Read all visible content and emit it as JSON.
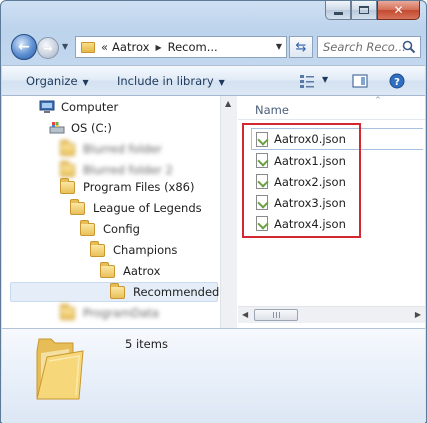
{
  "window": {
    "caption": {
      "minimize": "minimize",
      "maximize": "maximize",
      "close": "close"
    }
  },
  "address_bar": {
    "overflow": "«",
    "segments": [
      "Aatrox",
      "Recom..."
    ],
    "search_placeholder": "Search Reco..."
  },
  "toolbar": {
    "organize": "Organize",
    "include_in_library": "Include in library"
  },
  "nav_tree": [
    {
      "label": "Computer",
      "icon": "computer-icon",
      "blurred": false
    },
    {
      "label": "OS (C:)",
      "icon": "drive-icon",
      "blurred": false
    },
    {
      "label": "Blurred folder",
      "icon": "folder-icon",
      "blurred": true
    },
    {
      "label": "Blurred folder 2",
      "icon": "folder-icon",
      "blurred": true
    },
    {
      "label": "Program Files (x86)",
      "icon": "folder-icon",
      "blurred": false
    },
    {
      "label": "League of Legends",
      "icon": "folder-icon",
      "blurred": false
    },
    {
      "label": "Config",
      "icon": "folder-icon",
      "blurred": false
    },
    {
      "label": "Champions",
      "icon": "folder-icon",
      "blurred": false
    },
    {
      "label": "Aatrox",
      "icon": "folder-icon",
      "blurred": false
    },
    {
      "label": "Recommended",
      "icon": "folder-icon",
      "blurred": false,
      "selected": true
    },
    {
      "label": "ProgramData",
      "icon": "folder-icon",
      "blurred": true
    }
  ],
  "file_list": {
    "column_header": "Name",
    "files": [
      "Aatrox0.json",
      "Aatrox1.json",
      "Aatrox2.json",
      "Aatrox3.json",
      "Aatrox4.json"
    ],
    "highlight_color": "#d3282f"
  },
  "details_pane": {
    "item_count": "5 items"
  }
}
